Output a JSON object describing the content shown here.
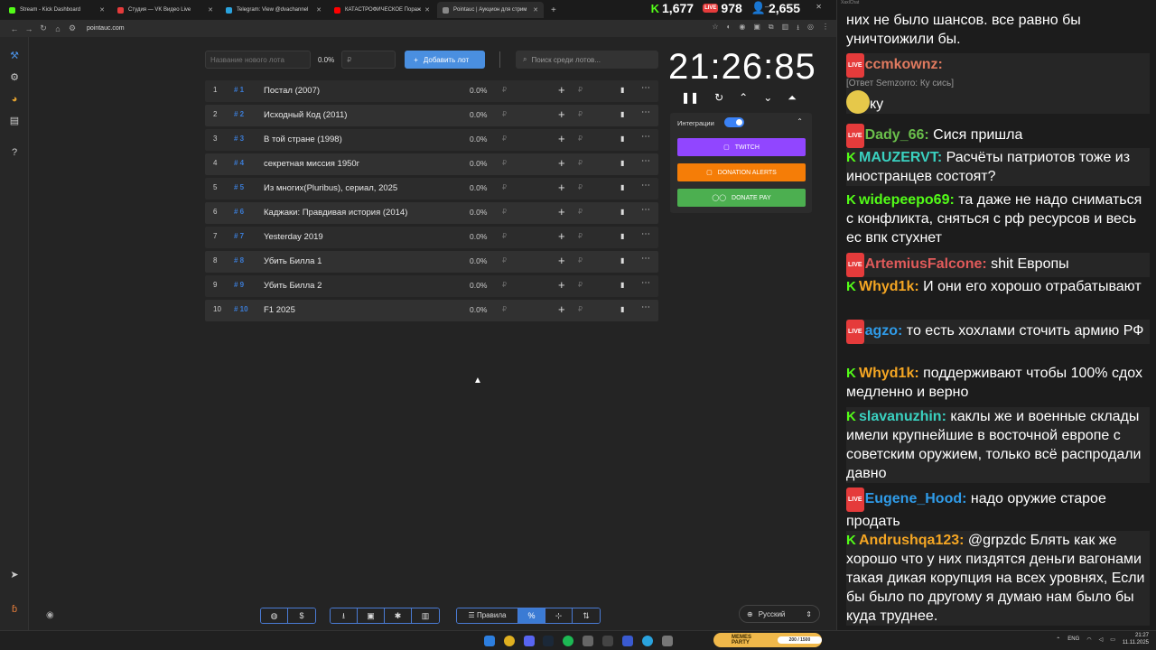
{
  "browser": {
    "tabs": [
      {
        "title": "Stream - Kick Dashboard",
        "color": "#53fc18"
      },
      {
        "title": "Студия — VK Видео Live",
        "color": "#e53b3b"
      },
      {
        "title": "Telegram: View @dvachannel",
        "color": "#2aa3de"
      },
      {
        "title": "КАТАСТРОФИЧЕСКОЕ Пораж",
        "color": "#ff0000"
      },
      {
        "title": "Pointauc | Аукцион для стрим",
        "color": "#888888"
      }
    ],
    "url": "pointauc.com"
  },
  "stats": {
    "kick": "1,677",
    "vk": "978",
    "viewers": "2,655"
  },
  "lots": {
    "new_lot_placeholder": "Название нового лота",
    "new_lot_percent": "0.0%",
    "amount_placeholder": "₽",
    "add_button": "Добавить лот",
    "search_placeholder": "Поиск среди лотов...",
    "items": [
      {
        "num": "1",
        "id": "# 1",
        "name": "Постал (2007)",
        "pct": "0.0%"
      },
      {
        "num": "2",
        "id": "# 2",
        "name": "Исходный Код (2011)",
        "pct": "0.0%"
      },
      {
        "num": "3",
        "id": "# 3",
        "name": "В той стране (1998)",
        "pct": "0.0%"
      },
      {
        "num": "4",
        "id": "# 4",
        "name": "секретная миссия 1950г",
        "pct": "0.0%"
      },
      {
        "num": "5",
        "id": "# 5",
        "name": "Из многих(Pluribus), сериал, 2025",
        "pct": "0.0%"
      },
      {
        "num": "6",
        "id": "# 6",
        "name": "Каджаки: Правдивая история (2014)",
        "pct": "0.0%"
      },
      {
        "num": "7",
        "id": "# 7",
        "name": "Yesterday 2019",
        "pct": "0.0%"
      },
      {
        "num": "8",
        "id": "# 8",
        "name": "Убить Билла 1",
        "pct": "0.0%"
      },
      {
        "num": "9",
        "id": "# 9",
        "name": "Убить Билла 2",
        "pct": "0.0%"
      },
      {
        "num": "10",
        "id": "# 10",
        "name": "F1 2025",
        "pct": "0.0%"
      }
    ],
    "currency": "₽"
  },
  "timer": {
    "value": "21:26:85"
  },
  "integrations": {
    "label": "Интеграции",
    "twitch": "TWITCH",
    "donation_alerts": "DONATION ALERTS",
    "donate_pay": "DONATE PAY"
  },
  "bottom": {
    "rules": "Правила",
    "language": "Русский"
  },
  "chat": {
    "window_title": "XaxlChat",
    "fragment": "них не было шансов. все равно бы уничтоижили бы.",
    "messages": [
      {
        "badge": "live",
        "nick": "ccmkownz:",
        "color": "#e07a5f",
        "reply": "[Ответ Semzorro: Ку сись]",
        "text": "ку"
      },
      {
        "badge": "live",
        "nick": "Dady_66:",
        "color": "#6abf4b",
        "text": "Сися пришла"
      },
      {
        "badge": "kick",
        "nick": "MAUZERVT:",
        "color": "#3ad1c0",
        "text": "Расчёты патриотов тоже из иностранцев состоят?"
      },
      {
        "badge": "kick",
        "nick": "widepeepo69:",
        "color": "#53fc18",
        "text": "та даже не надо сниматься с конфликта, сняться с рф ресурсов и весь ес впк стухнет"
      },
      {
        "badge": "live",
        "nick": "ArtemiusFalcone:",
        "color": "#e05a5a",
        "text": "shit Европы"
      },
      {
        "badge": "kick",
        "nick": "Whyd1k:",
        "color": "#f5a623",
        "text": "И они его хорошо отрабатывают"
      },
      {
        "badge": "live",
        "nick": "agzo:",
        "color": "#2f9be8",
        "text": "то есть хохлами сточить армию РФ"
      },
      {
        "badge": "kick",
        "nick": "Whyd1k:",
        "color": "#f5a623",
        "text": "поддерживают чтобы 100% сдох медленно и верно"
      },
      {
        "badge": "kick",
        "nick": "slavanuzhin:",
        "color": "#3ad1c0",
        "text": "каклы же и военные склады имели крупнейшие в восточной европе с советским оружием, только всё распродали давно"
      },
      {
        "badge": "live",
        "nick": "Eugene_Hood:",
        "color": "#2f9be8",
        "text": "надо оружие старое продать"
      },
      {
        "badge": "kick",
        "nick": "Andrushqa123:",
        "color": "#f5a623",
        "text": "@grpzdc Блять как же хорошо что у них пиздятся деньги вагонами такая дикая корупция на всех уровнях, Если бы было по другому я думаю нам было бы куда труднее."
      }
    ]
  },
  "taskbar": {
    "memes_label": "MEMES PARTY",
    "memes_progress": "200 / 1500",
    "lang": "ENG",
    "time": "21:27",
    "date": "11.11.2025"
  }
}
